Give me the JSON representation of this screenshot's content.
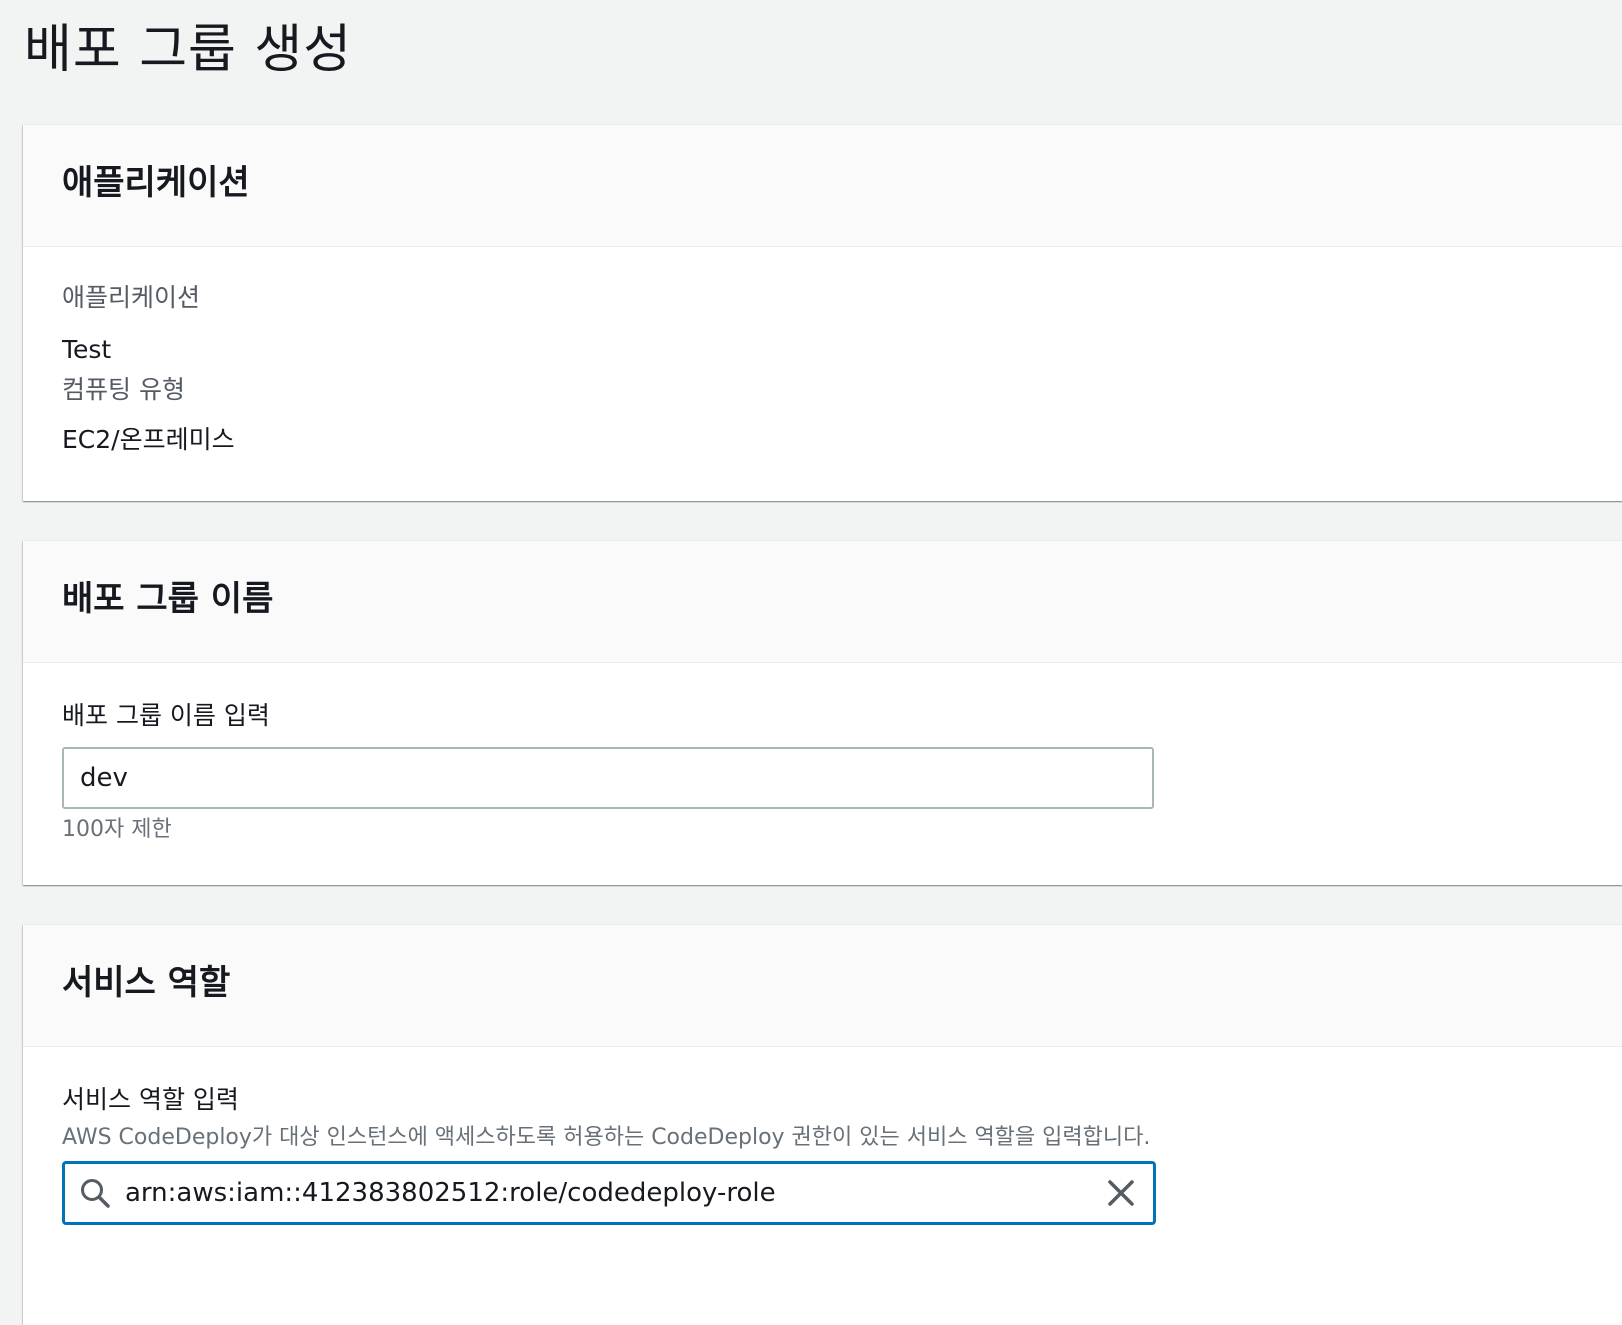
{
  "page": {
    "title": "배포 그룹 생성"
  },
  "application_section": {
    "header": "애플리케이션",
    "application_label": "애플리케이션",
    "application_value": "Test",
    "compute_type_label": "컴퓨팅 유형",
    "compute_type_value": "EC2/온프레미스"
  },
  "group_name_section": {
    "header": "배포 그룹 이름",
    "input_label": "배포 그룹 이름 입력",
    "input_value": "dev",
    "constraint": "100자 제한"
  },
  "service_role_section": {
    "header": "서비스 역할",
    "input_label": "서비스 역할 입력",
    "description": "AWS CodeDeploy가 대상 인스턴스에 액세스하도록 허용하는 CodeDeploy 권한이 있는 서비스 역할을 입력합니다.",
    "input_value": "arn:aws:iam::412383802512:role/codedeploy-role"
  },
  "icons": {
    "search": "search-icon",
    "clear": "close-icon"
  },
  "colors": {
    "page_background": "#f2f3f3",
    "focus_border": "#0073bb",
    "muted_text": "#545b64"
  }
}
